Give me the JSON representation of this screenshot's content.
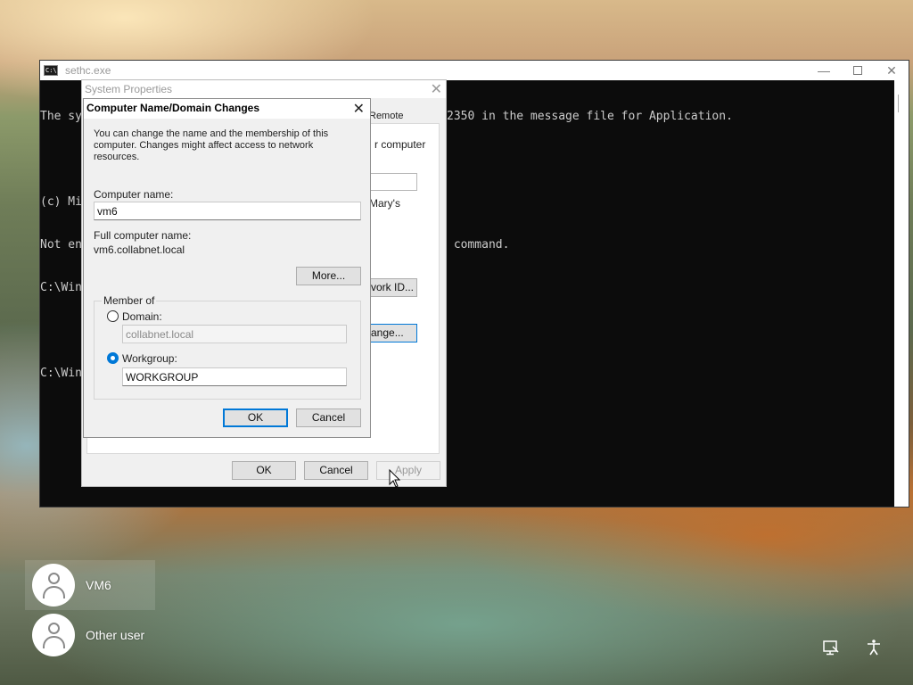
{
  "console": {
    "title": "sethc.exe",
    "lines": [
      "The sy",
      "",
      "(c) Mi",
      "Not en",
      "C:\\Win",
      "",
      "C:\\Win"
    ],
    "right_lines": [
      "2350 in the message file for Application.",
      "",
      "",
      " command."
    ],
    "icon": "console-icon",
    "minimize_glyph": "—",
    "close_glyph": "✕"
  },
  "system_properties": {
    "title": "System Properties",
    "close_glyph": "✕",
    "tab_remote": "Remote",
    "text_computer": "r computer",
    "text_marys": "Mary's",
    "network_id_button": "vork ID...",
    "change_button": "ange...",
    "ok_button": "OK",
    "cancel_button": "Cancel",
    "apply_button": "Apply"
  },
  "name_dialog": {
    "title": "Computer Name/Domain Changes",
    "close_glyph": "✕",
    "description": "You can change the name and the membership of this computer. Changes might affect access to network resources.",
    "computer_name_label": "Computer name:",
    "computer_name_value": "vm6",
    "full_name_label": "Full computer name:",
    "full_name_value": "vm6.collabnet.local",
    "more_button": "More...",
    "member_of_label": "Member of",
    "domain_label": "Domain:",
    "domain_value": "collabnet.local",
    "workgroup_label": "Workgroup:",
    "workgroup_value": "WORKGROUP",
    "selected_membership": "Workgroup",
    "ok_button": "OK",
    "cancel_button": "Cancel"
  },
  "login": {
    "users": [
      {
        "name": "VM6"
      },
      {
        "name": "Other user"
      }
    ],
    "tray_icons": [
      "network-icon",
      "accessibility-icon"
    ]
  },
  "colors": {
    "accent": "#0078d7",
    "console_bg": "#0c0c0c",
    "dialog_bg": "#f0f0f0"
  }
}
